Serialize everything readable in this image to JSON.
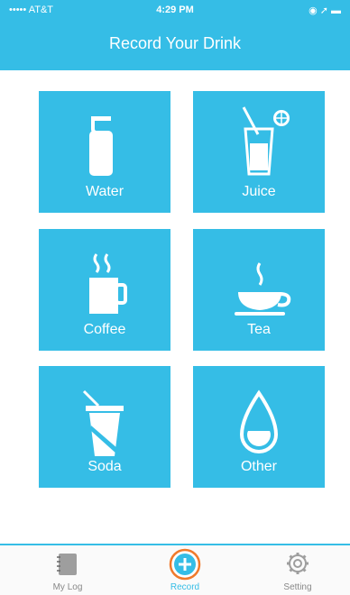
{
  "status_bar": {
    "carrier": "••••• AT&T",
    "time": "4:29 PM",
    "indicators": "◉ ➚ ▬"
  },
  "header": {
    "title": "Record Your Drink"
  },
  "drinks": [
    {
      "label": "Water",
      "icon": "water-bottle-icon"
    },
    {
      "label": "Juice",
      "icon": "juice-glass-icon"
    },
    {
      "label": "Coffee",
      "icon": "coffee-mug-icon"
    },
    {
      "label": "Tea",
      "icon": "tea-cup-icon"
    },
    {
      "label": "Soda",
      "icon": "soda-cup-icon"
    },
    {
      "label": "Other",
      "icon": "drop-icon"
    }
  ],
  "tabbar": {
    "tabs": [
      {
        "label": "My Log",
        "icon": "notebook-icon",
        "active": false
      },
      {
        "label": "Record",
        "icon": "plus-icon",
        "active": true
      },
      {
        "label": "Setting",
        "icon": "gear-icon",
        "active": false
      }
    ]
  },
  "colors": {
    "accent": "#35bde6",
    "record_ring": "#f07a2b"
  }
}
